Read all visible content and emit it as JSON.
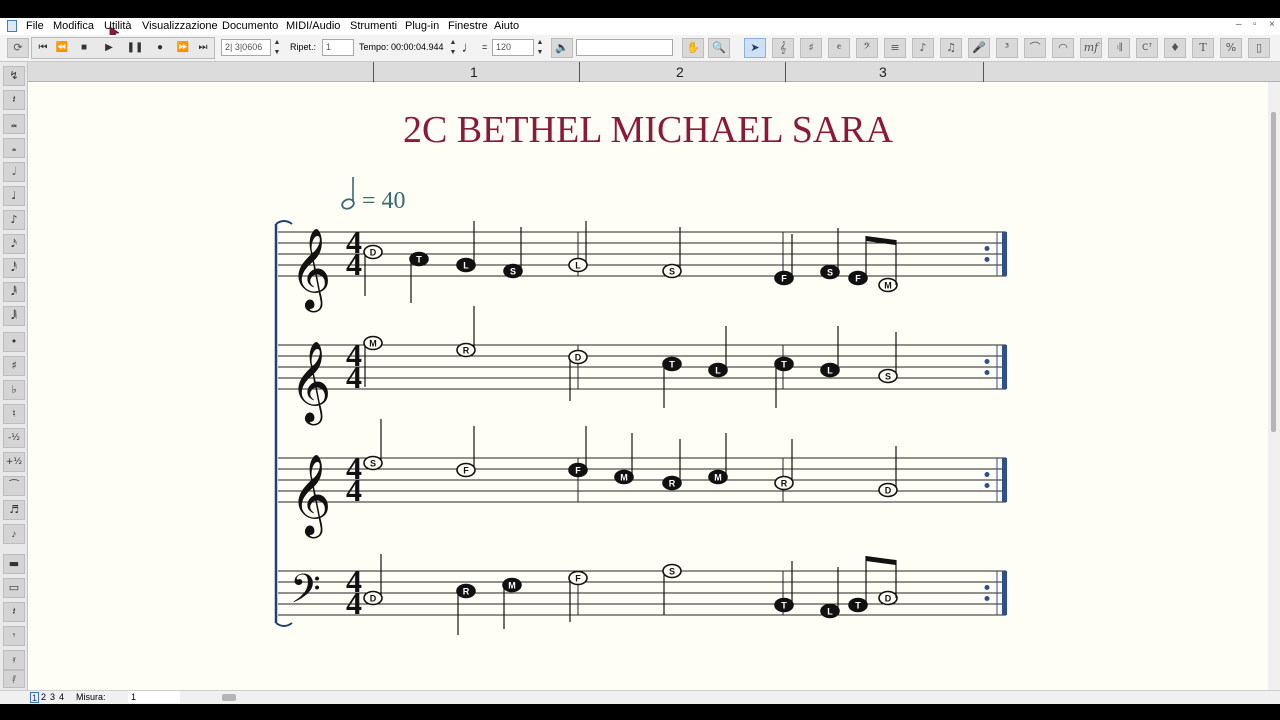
{
  "menubar": {
    "items": [
      "File",
      "Modifica",
      "Utilità",
      "Visualizzazione",
      "Documento",
      "MIDI/Audio",
      "Strumenti",
      "Plug-in",
      "Finestre",
      "Aiuto"
    ]
  },
  "toolbar": {
    "position_value": "2| 3|0606",
    "repeat_label": "Ripet.:",
    "repeat_value": "1",
    "time_label": "Tempo: 00:00:04.944",
    "tempo_equals": "=",
    "tempo_value": "120"
  },
  "ruler": {
    "measures": [
      "1",
      "2",
      "3"
    ]
  },
  "score": {
    "title": "2C BETHEL MICHAEL SARA",
    "tempo_mark_value": "= 40",
    "time_signature": {
      "top": "4",
      "bottom": "4"
    },
    "staves": [
      {
        "clef": "treble",
        "notes": [
          {
            "label": "D",
            "filled": false,
            "beam": null
          },
          {
            "label": "T",
            "filled": true
          },
          {
            "label": "L",
            "filled": true
          },
          {
            "label": "S",
            "filled": true
          },
          {
            "label": "L",
            "filled": false
          },
          {
            "label": "S",
            "filled": false
          },
          {
            "label": "F",
            "filled": true
          },
          {
            "label": "S",
            "filled": true
          },
          {
            "label": "F",
            "filled": true
          },
          {
            "label": "M",
            "filled": false
          }
        ]
      },
      {
        "clef": "treble",
        "notes": [
          {
            "label": "M",
            "filled": false
          },
          {
            "label": "R",
            "filled": false
          },
          {
            "label": "D",
            "filled": false
          },
          {
            "label": "T",
            "filled": true
          },
          {
            "label": "L",
            "filled": true
          },
          {
            "label": "T",
            "filled": true
          },
          {
            "label": "L",
            "filled": true
          },
          {
            "label": "S",
            "filled": false
          }
        ]
      },
      {
        "clef": "treble",
        "notes": [
          {
            "label": "S",
            "filled": false
          },
          {
            "label": "F",
            "filled": false
          },
          {
            "label": "F",
            "filled": true
          },
          {
            "label": "M",
            "filled": true
          },
          {
            "label": "R",
            "filled": true
          },
          {
            "label": "M",
            "filled": true
          },
          {
            "label": "R",
            "filled": false
          },
          {
            "label": "D",
            "filled": false
          }
        ]
      },
      {
        "clef": "bass",
        "notes": [
          {
            "label": "D",
            "filled": false
          },
          {
            "label": "R",
            "filled": true
          },
          {
            "label": "M",
            "filled": true
          },
          {
            "label": "F",
            "filled": false
          },
          {
            "label": "S",
            "filled": false
          },
          {
            "label": "T",
            "filled": true
          },
          {
            "label": "L",
            "filled": true
          },
          {
            "label": "T",
            "filled": true
          },
          {
            "label": "D",
            "filled": false
          }
        ]
      }
    ]
  },
  "statusbar": {
    "pages": [
      "1",
      "2",
      "3",
      "4"
    ],
    "measure_label": "Misura:",
    "measure_value": "1"
  },
  "icons": {
    "tempo_note": "half-note-icon",
    "tempo_toolbar_note": "quarter-note-icon"
  },
  "colors": {
    "title": "#8b1a3a",
    "tempo": "#3a6b6b",
    "barline_final": "#2f4f8f",
    "staff": "#000000"
  }
}
